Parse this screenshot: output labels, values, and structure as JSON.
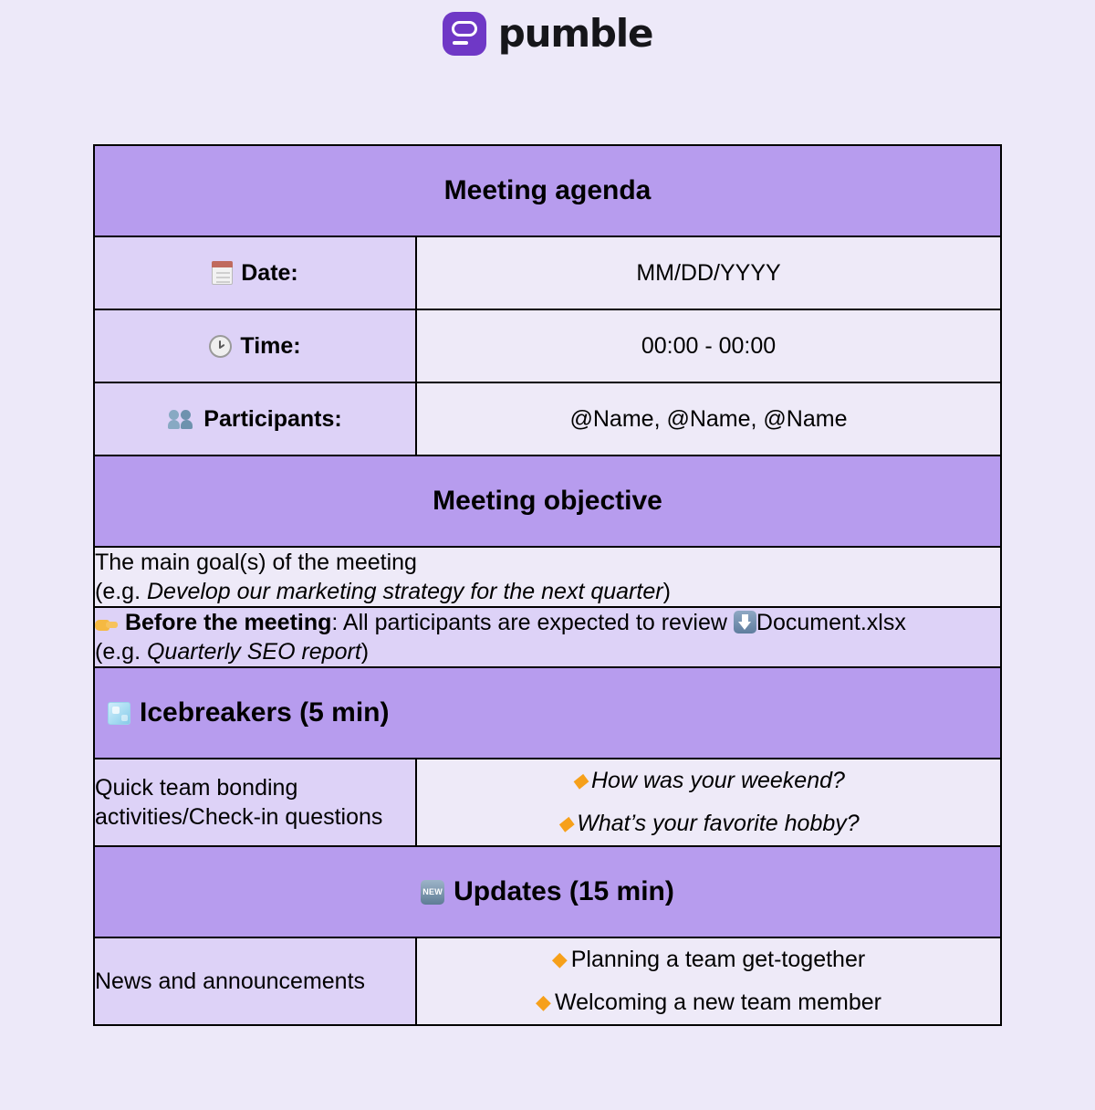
{
  "brand": {
    "name": "pumble",
    "logo_color": "#6f38c6"
  },
  "colors": {
    "page_bg": "#ede9f9",
    "band_purple": "#b79cee",
    "key_lavender": "#ddd2f7",
    "value_light": "#eeeaf8",
    "border": "#000000",
    "bullet_orange": "#f6a01a"
  },
  "agenda": {
    "title": "Meeting agenda",
    "info_rows": [
      {
        "icon": "notepad-icon",
        "label": "Date:",
        "value": "MM/DD/YYYY"
      },
      {
        "icon": "clock-icon",
        "label": "Time:",
        "value": "00:00 - 00:00"
      },
      {
        "icon": "busts-icon",
        "label": "Participants:",
        "value": "@Name, @Name, @Name"
      }
    ],
    "objective": {
      "title": "Meeting objective",
      "line1": "The main goal(s) of the meeting",
      "line2_prefix": "(e.g. ",
      "line2_italic": "Develop our marketing strategy for the next quarter",
      "line2_suffix": ")"
    },
    "before_meeting": {
      "hand_icon": "pointing-hand-icon",
      "bold_label": "Before the meeting",
      "text_after_label": ": All participants are expected to review",
      "download_icon": "download-icon",
      "file_name": "Document.xlsx",
      "example_prefix": "(e.g. ",
      "example_italic": "Quarterly SEO report",
      "example_suffix": ")"
    },
    "icebreakers": {
      "icon": "ice-cube-icon",
      "title": "Icebreakers (5 min)",
      "description": "Quick team bonding activities/Check-in questions",
      "bullets": [
        "How was your weekend?",
        "What’s your favorite hobby?"
      ]
    },
    "updates": {
      "icon": "new-button-icon",
      "title": "Updates (15 min)",
      "description": "News and announcements",
      "bullets": [
        "Planning a team get-together",
        "Welcoming a new team member"
      ]
    }
  }
}
